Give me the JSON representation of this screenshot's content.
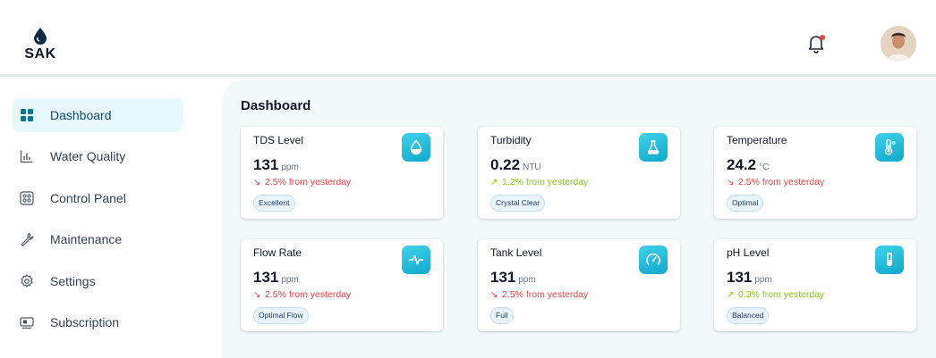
{
  "brand": {
    "name": "SAK"
  },
  "header": {
    "notification_icon": "bell-icon",
    "has_unread": true,
    "avatar_icon": "user-avatar"
  },
  "sidebar": {
    "items": [
      {
        "label": "Dashboard",
        "icon": "dashboard-grid-icon",
        "active": true
      },
      {
        "label": "Water Quality",
        "icon": "bar-chart-icon",
        "active": false
      },
      {
        "label": "Control Panel",
        "icon": "control-panel-icon",
        "active": false
      },
      {
        "label": "Maintenance",
        "icon": "wrench-icon",
        "active": false
      },
      {
        "label": "Settings",
        "icon": "gear-icon",
        "active": false
      },
      {
        "label": "Subscription",
        "icon": "subscription-icon",
        "active": false
      }
    ]
  },
  "main": {
    "title": "Dashboard",
    "cards": [
      {
        "title": "TDS Level",
        "value": "131",
        "unit": "ppm",
        "trend": "2.5% from yesterday",
        "trend_dir": "down",
        "badge": "Excellent",
        "icon": "water-drop-icon"
      },
      {
        "title": "Turbidity",
        "value": "0.22",
        "unit": "NTU",
        "trend": "1.2% from yesterday",
        "trend_dir": "up",
        "badge": "Crystal Clear",
        "icon": "flask-icon"
      },
      {
        "title": "Temperature",
        "value": "24.2",
        "unit": "°C",
        "trend": "2.5% from yesterday",
        "trend_dir": "down",
        "badge": "Optimal",
        "icon": "thermometer-icon"
      },
      {
        "title": "Flow Rate",
        "value": "131",
        "unit": "ppm",
        "trend": "2.5% from yesterday",
        "trend_dir": "down",
        "badge": "Optimal Flow",
        "icon": "pulse-icon"
      },
      {
        "title": "Tank Level",
        "value": "131",
        "unit": "ppm",
        "trend": "2.5% from yesterday",
        "trend_dir": "down",
        "badge": "Full",
        "icon": "gauge-icon"
      },
      {
        "title": "pH Level",
        "value": "131",
        "unit": "ppm",
        "trend": "0.3% from yesterday",
        "trend_dir": "up",
        "badge": "Balanced",
        "icon": "test-tube-icon"
      }
    ]
  },
  "colors": {
    "accent": "#16b3d4",
    "trend_down": "#ef4444",
    "trend_up": "#84cc16",
    "active_nav_bg": "#e6f8fb",
    "main_bg": "#f1f9f9"
  }
}
